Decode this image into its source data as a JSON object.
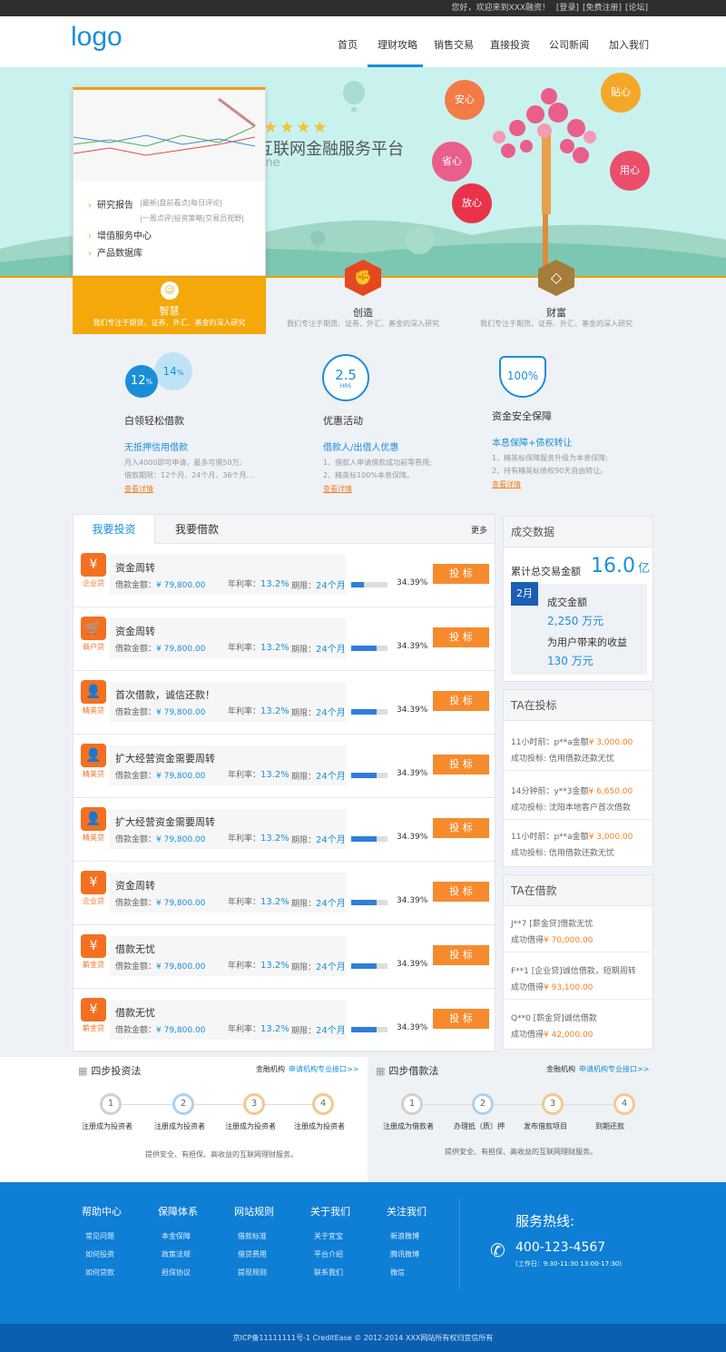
{
  "topbar": {
    "greeting": "您好，欢迎来到XXX融资！",
    "login": "[登录]",
    "register": "[免费注册]",
    "forum": "[论坛]"
  },
  "header": {
    "logo": "logo",
    "nav": [
      "首页",
      "理财攻略",
      "销售交易",
      "直接投资",
      "公司新闻",
      "加入我们"
    ],
    "active_nav": "理财攻略"
  },
  "banner": {
    "title": "互联网金融服务平台",
    "subtitle": "me",
    "hearts": [
      "安心",
      "贴心",
      "省心",
      "用心",
      "放心"
    ]
  },
  "dropdown": {
    "items": [
      "研究报告",
      "增值服务中心",
      "产品数据库"
    ],
    "sub1": "|最新|盘前看点|每日评论|",
    "sub2": "|一周点评|投资策略|交易员视野|"
  },
  "features": [
    {
      "title": "智慧",
      "desc": "我们专注于期货、证券、外汇、基金的深入研究"
    },
    {
      "title": "创造",
      "desc": "我们专注于期货、证券、外汇、基金的深入研究"
    },
    {
      "title": "财富",
      "desc": "我们专注于期货、证券、外汇、基金的深入研究"
    }
  ],
  "products": [
    {
      "title": "白领轻松借款",
      "sub": "无抵押信用借款",
      "desc1": "月入4000即可申请，最多可借50万;",
      "desc2": "借款期限：12个月、24个月、36个月...",
      "link": "查看详情",
      "badge1": "12",
      "badge2": "14"
    },
    {
      "title": "优惠活动",
      "sub": "借款人/出借人优惠",
      "desc1": "1、借款人申请借款成功前零费用;",
      "desc2": "2、精英标100%本息保障。",
      "link": "查看详情",
      "badge": "2.5",
      "badge_unit": "HRS"
    },
    {
      "title": "资金安全保障",
      "sub": "本息保障+债权转让",
      "desc1": "1、精英标保障服务升级为本息保障;",
      "desc2": "2、持有精英标债权90天自由转让。",
      "link": "查看详情",
      "badge": "100%"
    }
  ],
  "invest": {
    "tab_active": "我要投资",
    "tab_other": "我要借款",
    "more": "更多",
    "amount_label": "借款金额：",
    "rate_label": "年利率：",
    "term_label": "期限：",
    "button": "投 标",
    "rows": [
      {
        "icon": "money-bag",
        "icon_label": "企业贷",
        "name": "资金周转",
        "amount": "¥ 79,800.00",
        "rate": "13.2%",
        "term": "24个月",
        "pct": "34.39%",
        "progress": 0.34
      },
      {
        "icon": "cart",
        "icon_label": "商户贷",
        "name": "资金周转",
        "amount": "¥ 79,800.00",
        "rate": "13.2%",
        "term": "24个月",
        "pct": "34.39%",
        "progress": 0.7
      },
      {
        "icon": "person",
        "icon_label": "精英贷",
        "name": "首次借款，诚信还款！",
        "amount": "¥ 79,800.00",
        "rate": "13.2%",
        "term": "24个月",
        "pct": "34.39%",
        "progress": 0.7
      },
      {
        "icon": "person",
        "icon_label": "精英贷",
        "name": "扩大经营资金需要周转",
        "amount": "¥ 79,800.00",
        "rate": "13.2%",
        "term": "24个月",
        "pct": "34.39%",
        "progress": 0.7
      },
      {
        "icon": "person",
        "icon_label": "精英贷",
        "name": "扩大经营资金需要周转",
        "amount": "¥ 79,800.00",
        "rate": "13.2%",
        "term": "24个月",
        "pct": "34.39%",
        "progress": 0.7
      },
      {
        "icon": "money-bag",
        "icon_label": "企业贷",
        "name": "资金周转",
        "amount": "¥ 79,800.00",
        "rate": "13.2%",
        "term": "24个月",
        "pct": "34.39%",
        "progress": 0.7
      },
      {
        "icon": "cash",
        "icon_label": "薪金贷",
        "name": "借款无忧",
        "amount": "¥ 79,800.00",
        "rate": "13.2%",
        "term": "24个月",
        "pct": "34.39%",
        "progress": 0.7
      },
      {
        "icon": "cash",
        "icon_label": "薪金贷",
        "name": "借款无忧",
        "amount": "¥ 79,800.00",
        "rate": "13.2%",
        "term": "24个月",
        "pct": "34.39%",
        "progress": 0.7
      }
    ]
  },
  "deal": {
    "title": "成交数据",
    "total_label": "累计总交易金额",
    "total_value": "16.0",
    "total_unit": "亿",
    "month": "2月",
    "amount_label": "成交金额",
    "amount_value": "2,250 万元",
    "income_label": "为用户带来的收益",
    "income_value": "130 万元"
  },
  "ta_invest": {
    "title": "TA在投标",
    "items": [
      {
        "line1": "11小时前：p**a金额",
        "money": "¥ 3,000.00",
        "line2": "成功投标: 信用借款还款无忧"
      },
      {
        "line1": "14分钟前：y**3金额",
        "money": "¥ 6,650.00",
        "line2": "成功投标: 沈阳本地客户首次借款"
      },
      {
        "line1": "11小时前：p**a金额",
        "money": "¥ 3,000.00",
        "line2": "成功投标: 信用借款还款无忧"
      }
    ]
  },
  "ta_borrow": {
    "title": "TA在借款",
    "items": [
      {
        "line1": "J**7 [薪金贷]借款无忧",
        "line2": "成功借得",
        "money": "¥ 70,000.00"
      },
      {
        "line1": "F**1 [企业贷]诚信借款，短期周转",
        "line2": "成功借得",
        "money": "¥ 93,100.00"
      },
      {
        "line1": "Q**0 [薪金贷]诚信借款",
        "line2": "成功借得",
        "money": "¥ 42,000.00"
      }
    ]
  },
  "steps": {
    "invest_title": "四步投资法",
    "borrow_title": "四步借款法",
    "inst": "金融机构",
    "apply": "申请机构专业接口>>",
    "invest_labels": [
      "注册成为投资者",
      "注册成为投资者",
      "注册成为投资者",
      "注册成为投资者"
    ],
    "borrow_labels": [
      "注册成为借款者",
      "办理抵（质）押",
      "发布借款项目",
      "到期还款"
    ],
    "nums": [
      "1",
      "2",
      "3",
      "4"
    ],
    "foot": "提供安全、有担保、高收益的互联网理财服务。"
  },
  "footer": {
    "cols": [
      {
        "title": "帮助中心",
        "links": [
          "常见问题",
          "如何投资",
          "如何贷款"
        ]
      },
      {
        "title": "保障体系",
        "links": [
          "本金保障",
          "政策法规",
          "担保协议"
        ]
      },
      {
        "title": "网站规则",
        "links": [
          "借款标准",
          "借贷费用",
          "提现规则"
        ]
      },
      {
        "title": "关于我们",
        "links": [
          "关于宜宝",
          "平台介绍",
          "联系我们"
        ]
      },
      {
        "title": "关注我们",
        "links": [
          "新浪微博",
          "腾讯微博",
          "微信"
        ]
      }
    ],
    "hotline_label": "服务热线:",
    "hotline": "400-123-4567",
    "hours": "(工作日：9:30-11:30  13:00-17:30)",
    "copyright": "京ICP备11111111号-1 CreditEase © 2012-2014 XXX网站所有权归宜信所有"
  },
  "colors": {
    "brand": "#1a8fd8",
    "accent": "#f68b2e",
    "gold": "#f4a80a",
    "footer": "#0f7ed5"
  }
}
